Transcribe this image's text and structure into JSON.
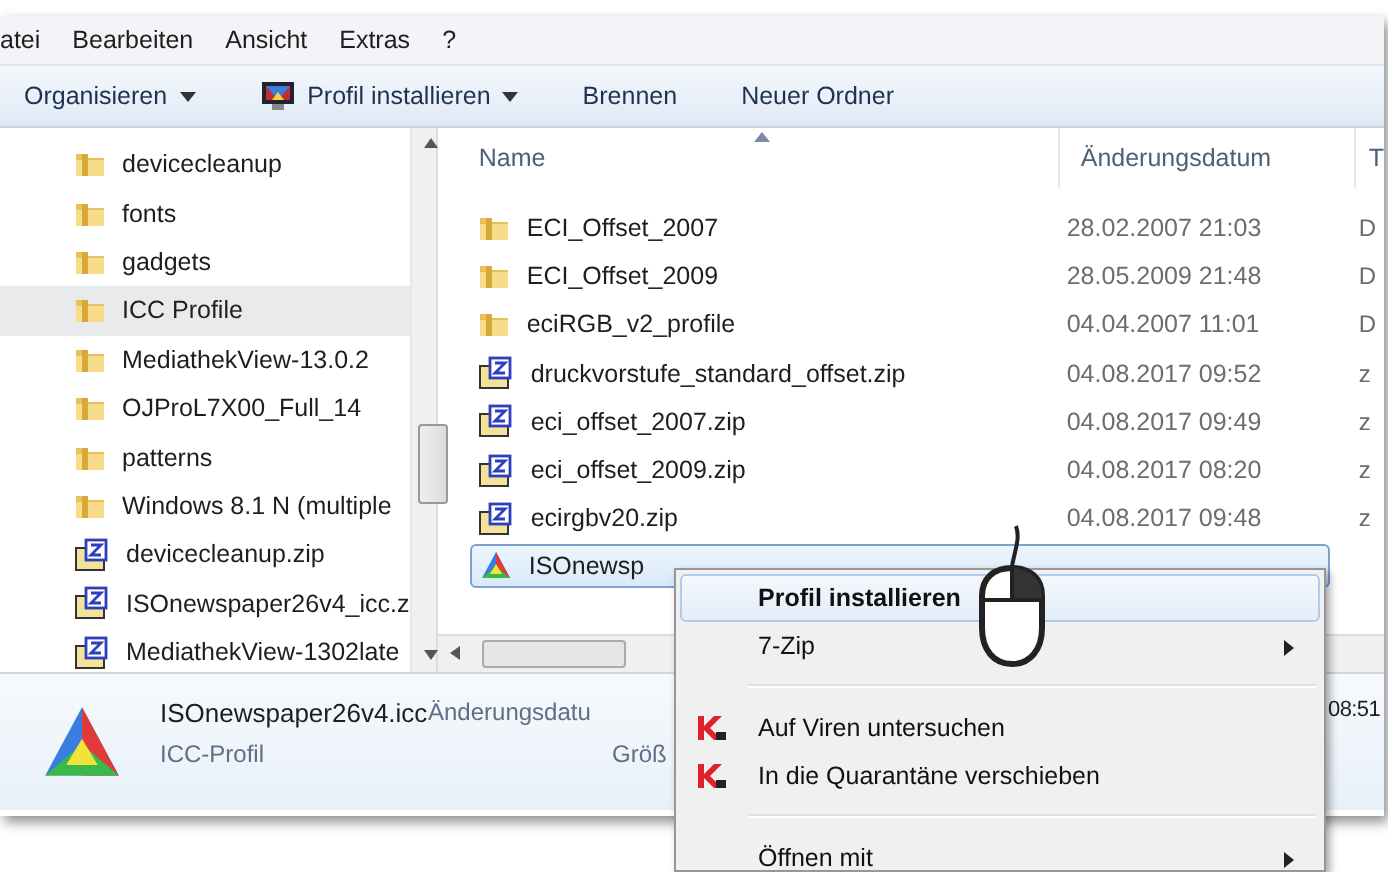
{
  "menubar": [
    "atei",
    "Bearbeiten",
    "Ansicht",
    "Extras",
    "?"
  ],
  "toolbar": [
    {
      "label": "Organisieren",
      "icon": false,
      "dropdown": true
    },
    {
      "label": "Profil installieren",
      "icon": true,
      "dropdown": true
    },
    {
      "label": "Brennen",
      "icon": false,
      "dropdown": false
    },
    {
      "label": "Neuer Ordner",
      "icon": false,
      "dropdown": false
    }
  ],
  "sidebar": {
    "items": [
      {
        "label": "devicecleanup",
        "kind": "folder",
        "selected": false
      },
      {
        "label": "fonts",
        "kind": "folder",
        "selected": false
      },
      {
        "label": "gadgets",
        "kind": "folder",
        "selected": false
      },
      {
        "label": "ICC Profile",
        "kind": "folder",
        "selected": true
      },
      {
        "label": "MediathekView-13.0.2",
        "kind": "folder",
        "selected": false
      },
      {
        "label": "OJProL7X00_Full_14",
        "kind": "folder",
        "selected": false
      },
      {
        "label": "patterns",
        "kind": "folder",
        "selected": false
      },
      {
        "label": "Windows 8.1 N (multiple",
        "kind": "folder",
        "selected": false
      },
      {
        "label": "devicecleanup.zip",
        "kind": "zip",
        "selected": false
      },
      {
        "label": "ISOnewspaper26v4_icc.z",
        "kind": "zip",
        "selected": false
      },
      {
        "label": "MediathekView-1302late",
        "kind": "zip",
        "selected": false
      }
    ]
  },
  "table": {
    "columns": [
      "Name",
      "Änderungsdatum",
      "T"
    ],
    "rows": [
      {
        "name": "ECI_Offset_2007",
        "date": "28.02.2007 21:03",
        "column_3": "D",
        "kind": "folder",
        "selected": false
      },
      {
        "name": "ECI_Offset_2009",
        "date": "28.05.2009 21:48",
        "column_3": "D",
        "kind": "folder",
        "selected": false
      },
      {
        "name": "eciRGB_v2_profile",
        "date": "04.04.2007 11:01",
        "column_3": "D",
        "kind": "folder",
        "selected": false
      },
      {
        "name": "druckvorstufe_standard_offset.zip",
        "date": "04.08.2017 09:52",
        "column_3": "z",
        "kind": "zip",
        "selected": false
      },
      {
        "name": "eci_offset_2007.zip",
        "date": "04.08.2017 09:49",
        "column_3": "z",
        "kind": "zip",
        "selected": false
      },
      {
        "name": "eci_offset_2009.zip",
        "date": "04.08.2017 08:20",
        "column_3": "z",
        "kind": "zip",
        "selected": false
      },
      {
        "name": "ecirgbv20.zip",
        "date": "04.08.2017 09:48",
        "column_3": "z",
        "kind": "zip",
        "selected": false
      },
      {
        "name": "ISOnewsp",
        "kind": "icc",
        "selected": true
      }
    ]
  },
  "details": {
    "filename": "ISOnewspaper26v4.icc",
    "type": "ICC-Profil",
    "label_1": "Änderungsdatu",
    "label_2": "Größ",
    "value_1": "08:51"
  },
  "context_menu": [
    {
      "kind": "item",
      "label": "Profil installieren",
      "bold": true,
      "highlighted": true,
      "submenu": false,
      "icon": false
    },
    {
      "kind": "item",
      "label": "7-Zip",
      "bold": false,
      "highlighted": false,
      "submenu": true,
      "icon": false
    },
    {
      "kind": "separator"
    },
    {
      "kind": "item",
      "label": "Auf Viren untersuchen",
      "bold": false,
      "highlighted": false,
      "submenu": false,
      "icon": true
    },
    {
      "kind": "item",
      "label": "In die Quarantäne verschieben",
      "bold": false,
      "highlighted": false,
      "submenu": false,
      "icon": true
    },
    {
      "kind": "separator"
    },
    {
      "kind": "item",
      "label": "Öffnen mit",
      "bold": false,
      "highlighted": false,
      "submenu": true,
      "icon": false
    }
  ]
}
